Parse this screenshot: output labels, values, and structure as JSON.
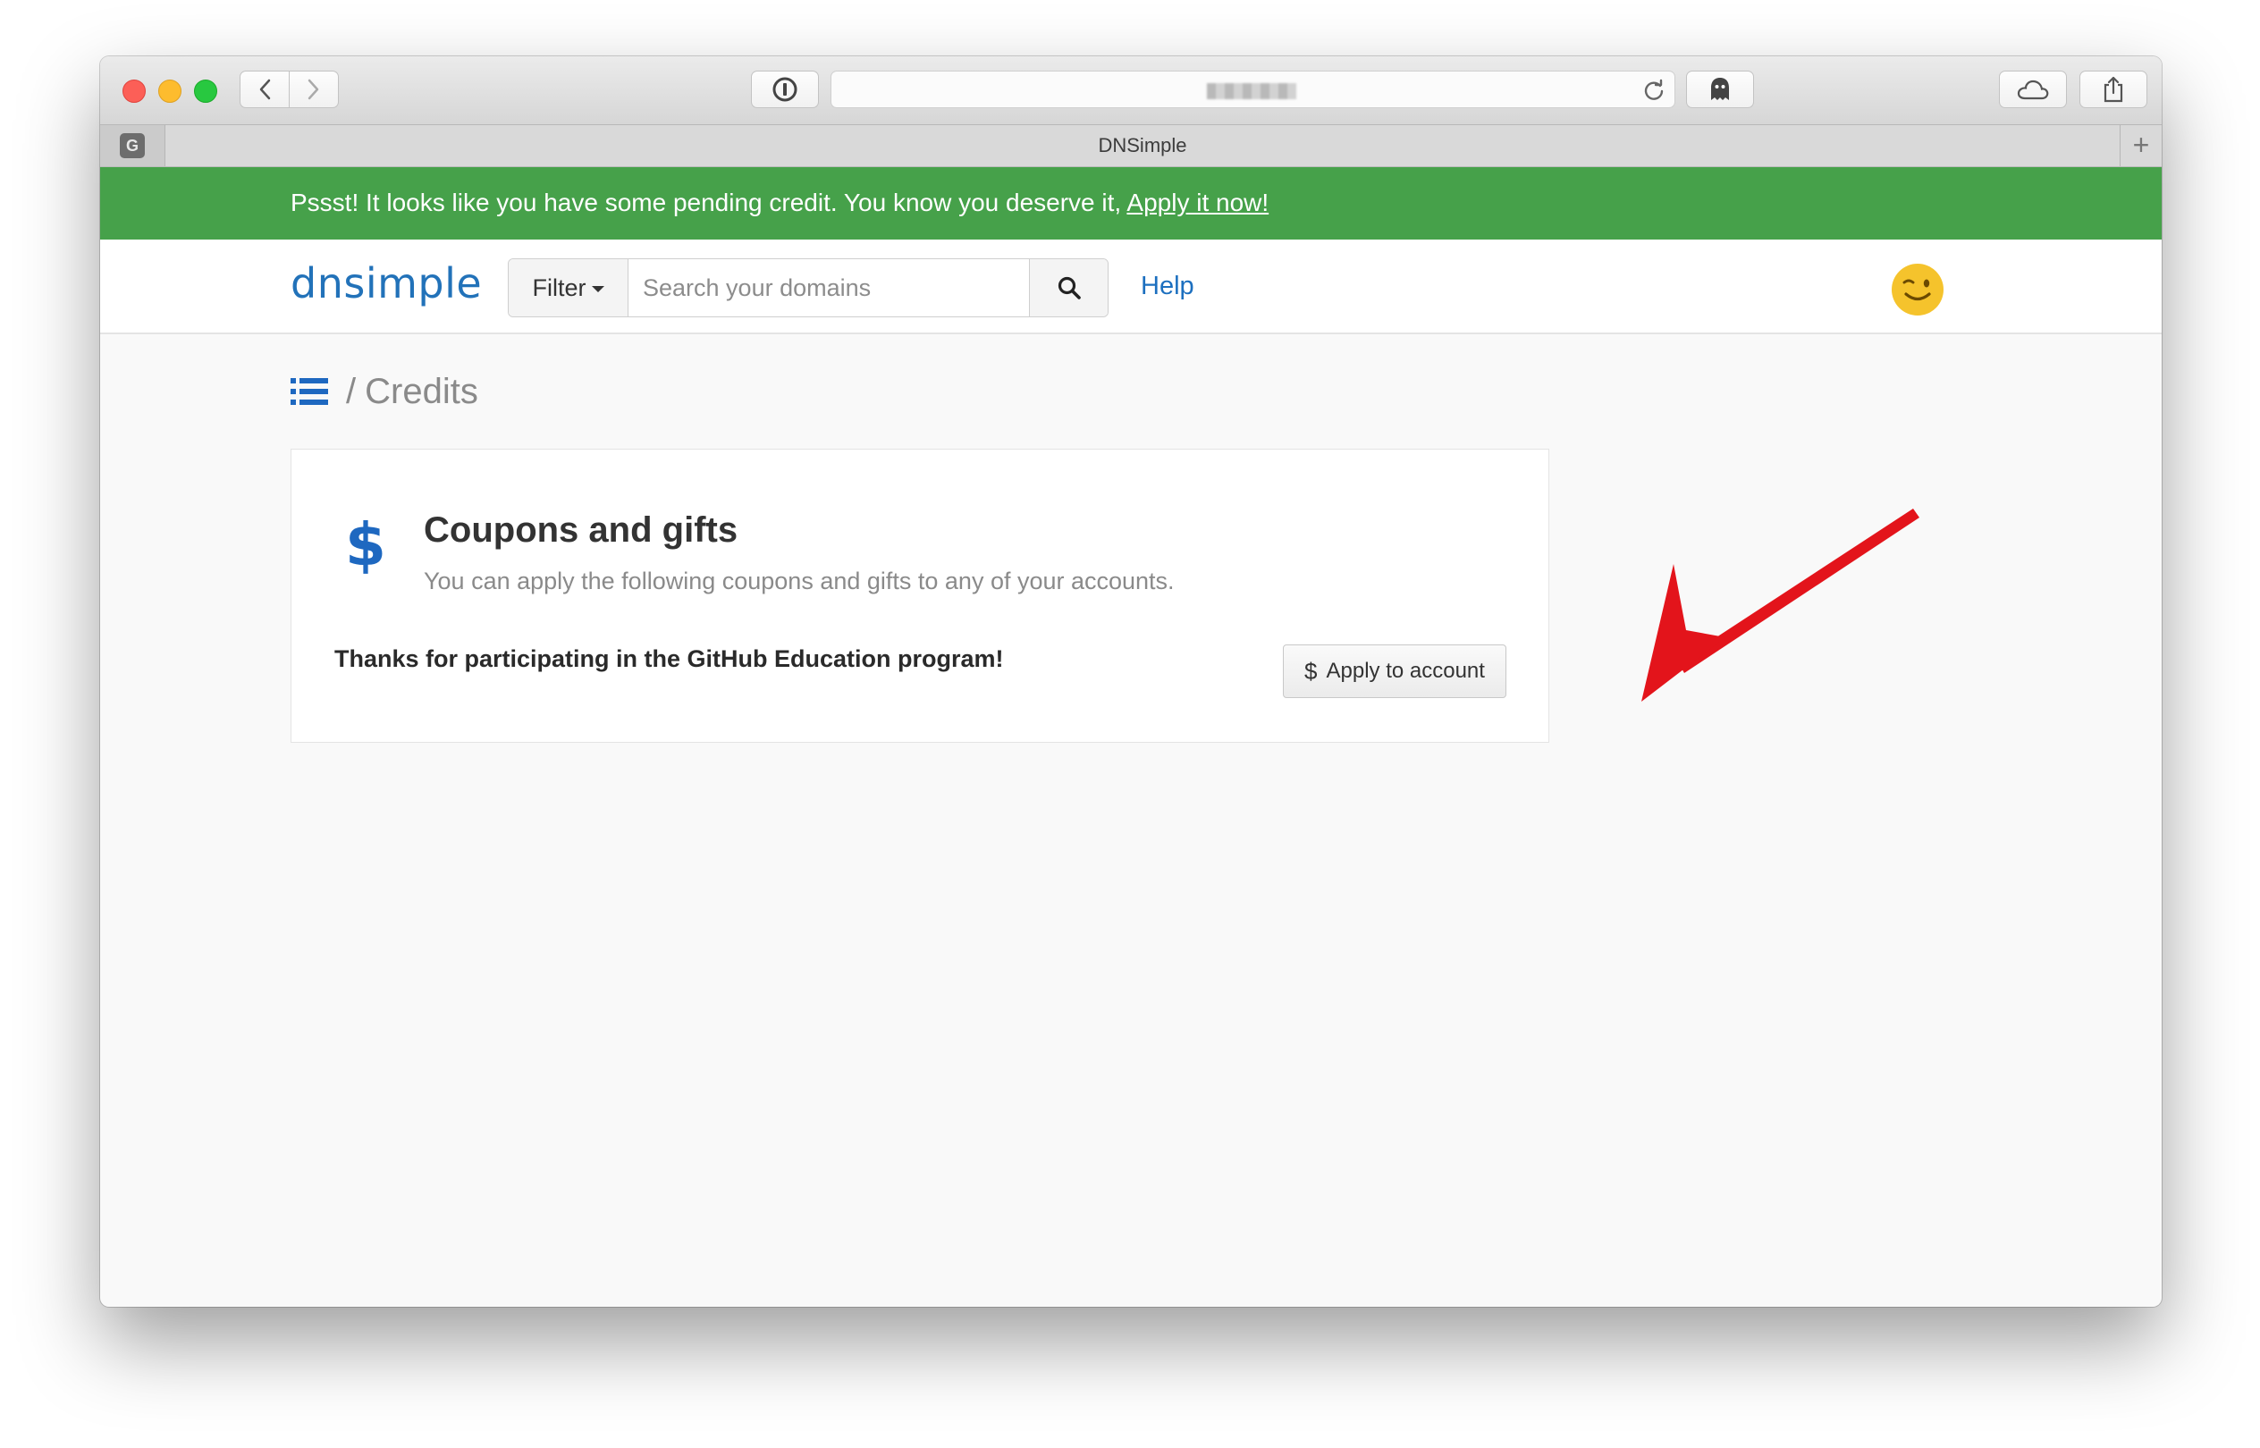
{
  "browser": {
    "tab_title": "DNSimple",
    "pinned_tab_letter": "G",
    "new_tab_symbol": "+"
  },
  "banner": {
    "message": "Pssst! It looks like you have some pending credit. You know you deserve it, ",
    "link": "Apply it now!",
    "color": "#46a14a"
  },
  "navbar": {
    "logo": "dnsimple",
    "filter_label": "Filter",
    "search_placeholder": "Search your domains",
    "help_label": "Help"
  },
  "breadcrumb": {
    "separator": "/",
    "current": "Credits"
  },
  "card": {
    "icon": "$",
    "title": "Coupons and gifts",
    "subtitle": "You can apply the following coupons and gifts to any of your accounts.",
    "coupon_text": "Thanks for participating in the GitHub Education program!",
    "apply_button": "Apply to account",
    "apply_icon": "$"
  },
  "colors": {
    "accent_blue": "#2272b9",
    "link_blue": "#1c6fbf",
    "annotation_red": "#e3141b"
  }
}
